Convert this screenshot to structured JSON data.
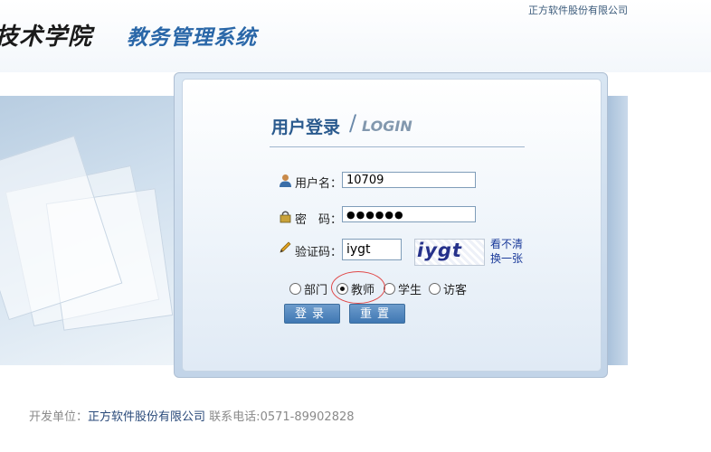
{
  "header": {
    "company_top": "正方软件股份有限公司",
    "school_name_partial": "技术学院",
    "system_name": "教务管理系统"
  },
  "login": {
    "title_cn": "用户登录",
    "title_sep": "/",
    "title_en": "LOGIN",
    "username_label": "用户名：",
    "username_value": "10709",
    "password_label": "密　码：",
    "password_value": "●●●●●●",
    "captcha_label": "验证码：",
    "captcha_value": "iygt",
    "captcha_image_text": "iygt",
    "refresh_link": "看不清换一张",
    "roles": [
      {
        "label": "部门",
        "checked": false
      },
      {
        "label": "教师",
        "checked": true
      },
      {
        "label": "学生",
        "checked": false
      },
      {
        "label": "访客",
        "checked": false
      }
    ],
    "login_button": "登录",
    "reset_button": "重置"
  },
  "footer": {
    "dev_label": "开发单位：",
    "dev_company": "正方软件股份有限公司",
    "contact_label": "联系电话:",
    "contact_phone": "0571-89902828"
  },
  "colors": {
    "brand_blue": "#2a67a8",
    "button_blue": "#3f77b3",
    "highlight_red": "#e04848"
  }
}
